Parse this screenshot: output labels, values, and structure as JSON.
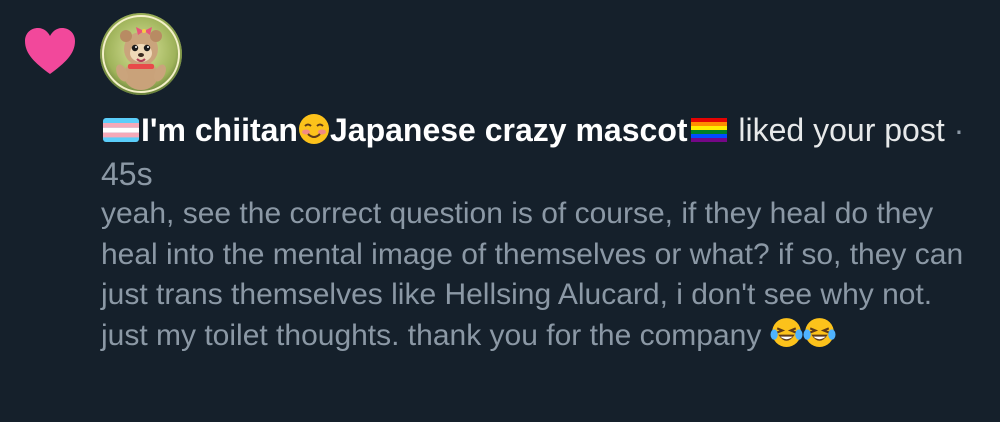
{
  "notification": {
    "type_icon": "heart-icon",
    "avatar_icon": "avatar-mascot",
    "user": {
      "name_before_emoji": "I'm chiitan",
      "name_after_emoji": "Japanese crazy mascot",
      "emojis": [
        "transgender-flag-emoji",
        "smiling-blush-emoji",
        "rainbow-flag-emoji"
      ]
    },
    "action_text": "liked",
    "action_text_line2": "your post",
    "separator": "·",
    "timestamp": "45s",
    "post_text": "yeah, see the correct question is of course, if they heal do they heal into the mental image of themselves or what? if so, they can just trans themselves like Hellsing Alucard, i don't see why not. just my toilet thoughts. thank you for the company",
    "post_emojis": [
      "laughing-tears-emoji",
      "laughing-tears-emoji"
    ]
  },
  "colors": {
    "background": "#15202b",
    "heart": "#f2489b",
    "primary_text": "#e7e9ea",
    "secondary_text": "#8b98a5"
  }
}
